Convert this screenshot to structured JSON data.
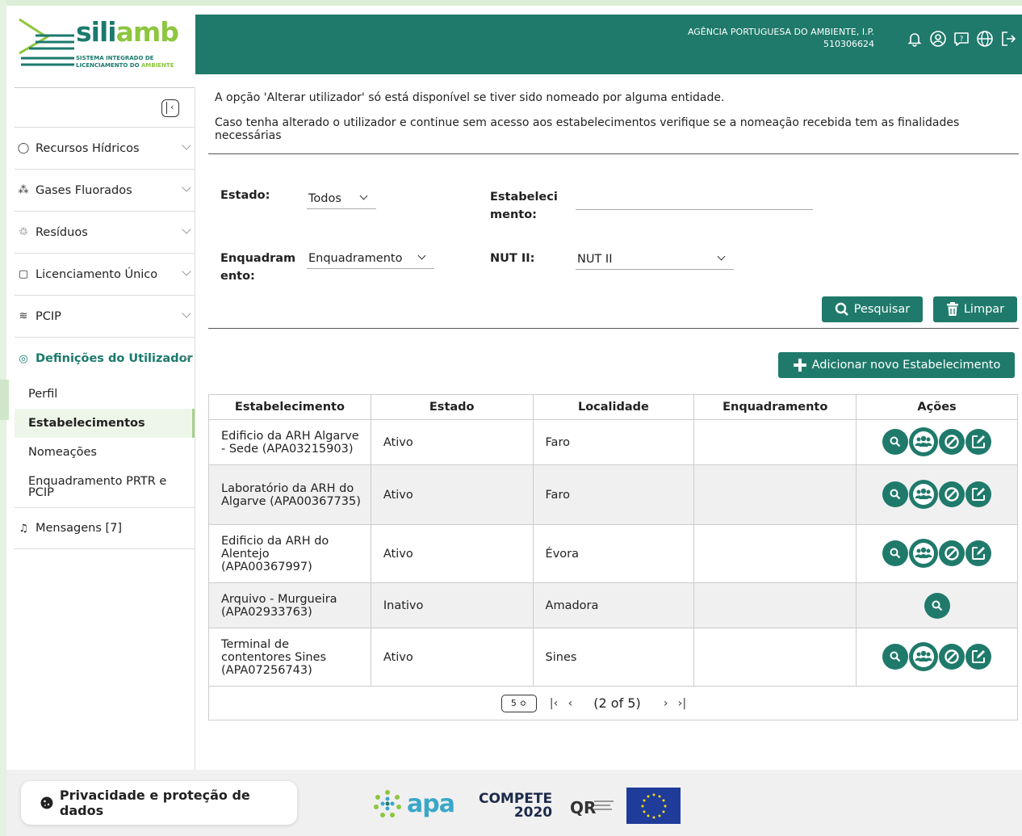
{
  "brand": {
    "name_part1": "sili",
    "name_part2": "amb",
    "subtitle_line1": "SISTEMA INTEGRADO DE",
    "subtitle_line2": "LICENCIAMENTO DO ",
    "subtitle_accent": "AMBIENTE"
  },
  "header": {
    "agency": "AGÊNCIA PORTUGUESA DO AMBIENTE, I.P.",
    "agency_id": "510306624",
    "icons": [
      "bell-icon",
      "user-circle-icon",
      "help-chat-icon",
      "globe-icon",
      "logout-icon"
    ]
  },
  "sidebar": {
    "items": [
      {
        "label": "Recursos Hídricos",
        "icon": "drop-icon"
      },
      {
        "label": "Gases Fluorados",
        "icon": "molecule-icon"
      },
      {
        "label": "Resíduos",
        "icon": "recycle-icon"
      },
      {
        "label": "Licenciamento Único",
        "icon": "document-icon"
      },
      {
        "label": "PCIP",
        "icon": "waves-icon"
      }
    ],
    "active_section": "Definições do Utilizador",
    "subitems": [
      "Perfil",
      "Estabelecimentos",
      "Nomeações",
      "Enquadramento PRTR e PCIP"
    ],
    "active_subitem": "Estabelecimentos",
    "messages": "Mensagens [7]"
  },
  "info": {
    "line1": "A opção 'Alterar utilizador' só está disponível se tiver sido nomeado por alguma entidade.",
    "line2": "Caso tenha alterado o utilizador e continue sem acesso aos estabelecimentos verifique se a nomeação recebida tem as finalidades necessárias"
  },
  "filters": {
    "estado_label": "Estado:",
    "estado_value": "Todos",
    "estab_label_1": "Estabeleci",
    "estab_label_2": "mento:",
    "estab_value": "",
    "enq_label_1": "Enquadram",
    "enq_label_2": "ento:",
    "enq_value": "Enquadramento",
    "nut_label": "NUT II:",
    "nut_value": "NUT II",
    "search_button": "Pesquisar",
    "clear_button": "Limpar"
  },
  "add_button": "Adicionar novo Estabelecimento",
  "table": {
    "headers": [
      "Estabelecimento",
      "Estado",
      "Localidade",
      "Enquadramento",
      "Ações"
    ],
    "rows": [
      {
        "name": "Edificio da ARH Algarve - Sede (APA03215903)",
        "estado": "Ativo",
        "localidade": "Faro",
        "enquadramento": "",
        "actions": "full"
      },
      {
        "name": "Laboratório da ARH do Algarve (APA00367735)",
        "estado": "Ativo",
        "localidade": "Faro",
        "enquadramento": "",
        "actions": "full"
      },
      {
        "name": "Edificio da ARH do Alentejo (APA00367997)",
        "estado": "Ativo",
        "localidade": "Évora",
        "enquadramento": "",
        "actions": "full"
      },
      {
        "name": "Arquivo - Murgueira (APA02933763)",
        "estado": "Inativo",
        "localidade": "Amadora",
        "enquadramento": "",
        "actions": "view"
      },
      {
        "name": "Terminal de contentores Sines (APA07256743)",
        "estado": "Ativo",
        "localidade": "Sines",
        "enquadramento": "",
        "actions": "full"
      }
    ]
  },
  "pager": {
    "page_size": "5",
    "status": "(2 of 5)"
  },
  "footer": {
    "privacy": "Privacidade e proteção de dados",
    "apa": "apa",
    "compete_1": "COMPETE",
    "compete_2": "2020"
  },
  "colors": {
    "primary": "#1f7a6b",
    "accent": "#8dc63f",
    "frame": "#dbeed7"
  }
}
